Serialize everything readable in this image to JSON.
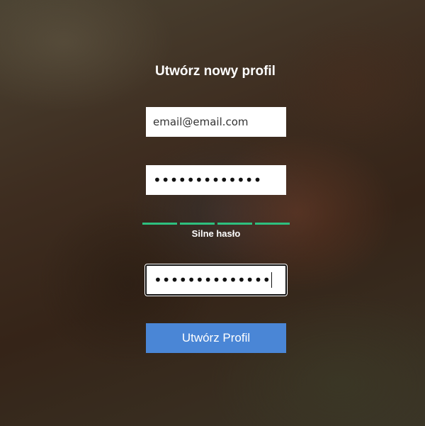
{
  "form": {
    "title": "Utwórz nowy profil",
    "email": {
      "value": "email@email.com"
    },
    "password": {
      "masked_value": "•••••••••••••"
    },
    "strength": {
      "label": "Silne hasło",
      "segments_filled": 4,
      "segments_total": 4,
      "color": "#2ec07f"
    },
    "confirm_password": {
      "masked_value": "••••••••••••••"
    },
    "submit_label": "Utwórz Profil"
  },
  "colors": {
    "button": "#4a86d6",
    "strength": "#2ec07f"
  }
}
